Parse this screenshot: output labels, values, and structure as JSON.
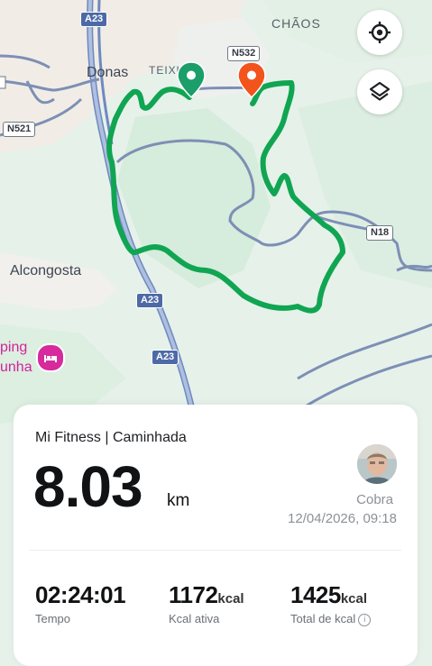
{
  "map": {
    "places": {
      "donas": "Donas",
      "teixu": "TEIXU",
      "chaos": "CHÃOS",
      "alcongosta": "Alcongosta",
      "camping_line1": "ping",
      "camping_line2": "unha"
    },
    "roads": {
      "a23_top": "A23",
      "a23_mid": "A23",
      "a23_bottom": "A23",
      "n532": "N532",
      "n521": "N521",
      "n18": "N18"
    },
    "buttons": {
      "locate_icon": "crosshair-target-icon",
      "layers_icon": "layers-icon"
    },
    "route_color": "#10a552",
    "start_marker_color": "#1b9e6a",
    "end_marker_color": "#f2541b"
  },
  "activity": {
    "source": "Mi Fitness | Caminhada",
    "distance": "8.03",
    "distance_unit": "km",
    "user": "Cobra",
    "datetime": "12/04/2026, 09:18",
    "stats": [
      {
        "value": "02:24:01",
        "unit": "",
        "label": "Tempo"
      },
      {
        "value": "1172",
        "unit": "kcal",
        "label": "Kcal ativa"
      },
      {
        "value": "1425",
        "unit": "kcal",
        "label": "Total de kcal"
      }
    ]
  }
}
